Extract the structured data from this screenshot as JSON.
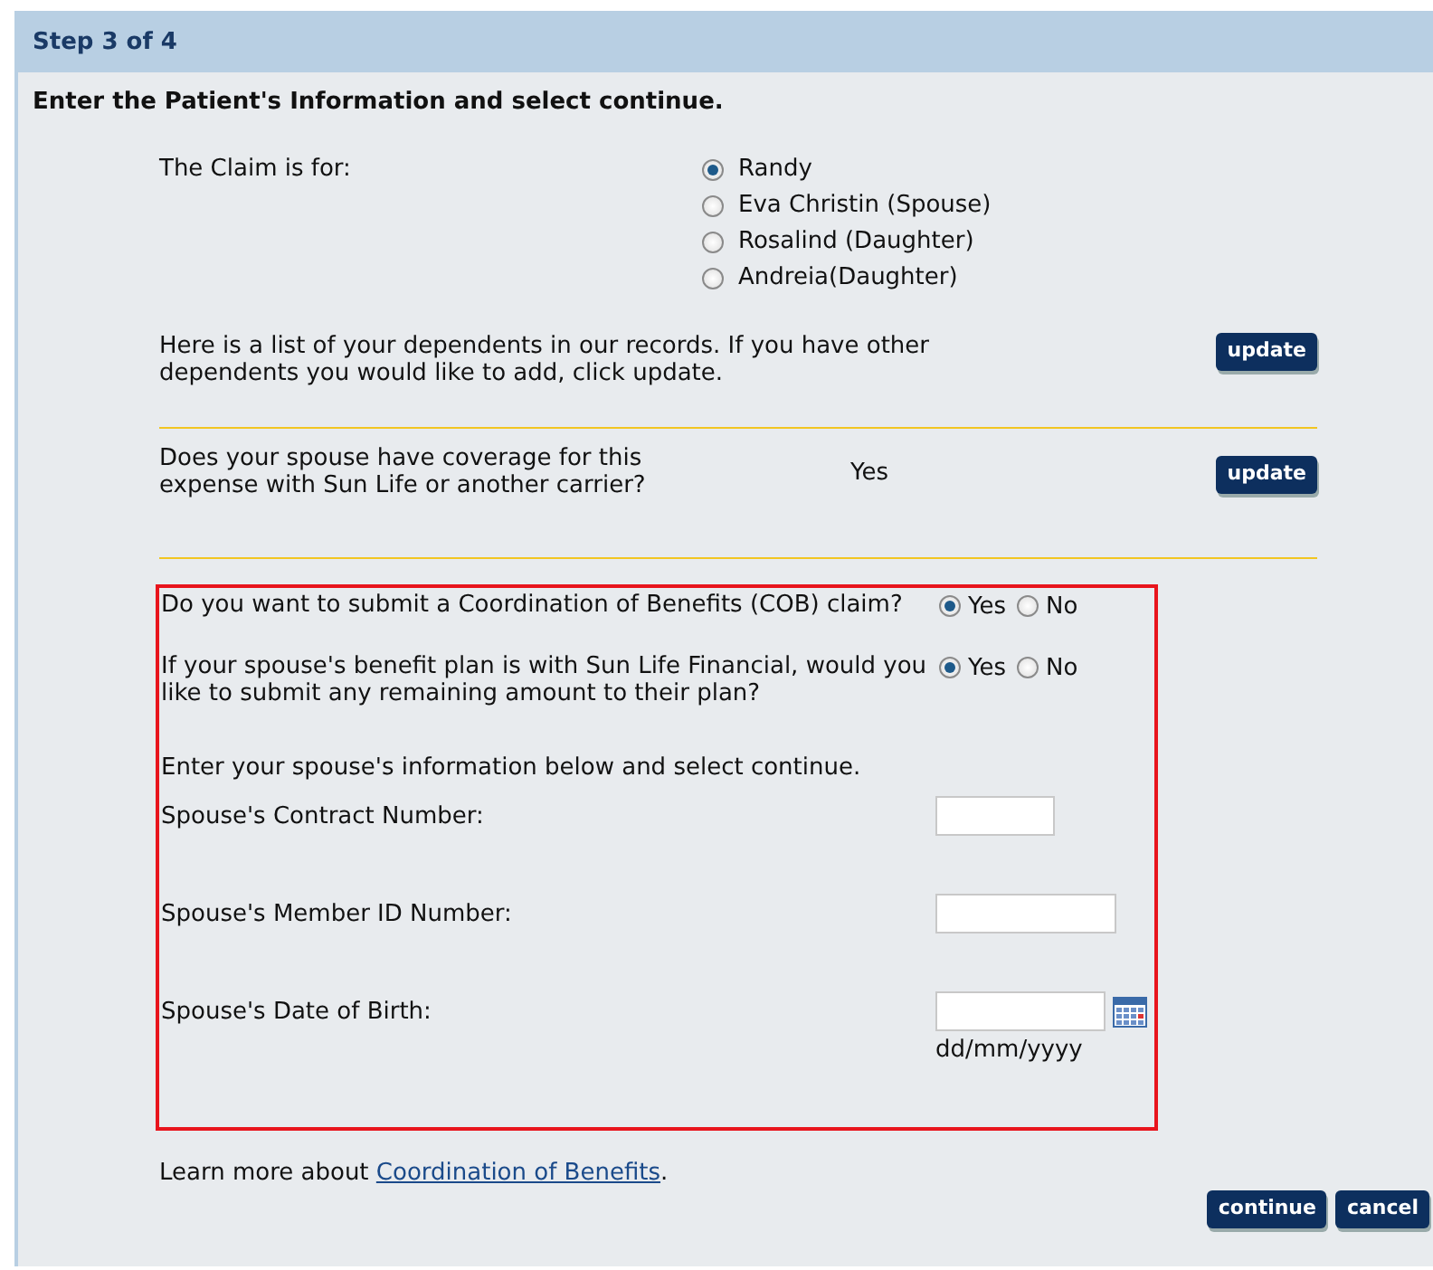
{
  "step": "Step 3 of 4",
  "instruction": "Enter the Patient's Information and select continue.",
  "claim": {
    "label": "The Claim is for:",
    "options": [
      {
        "label": "Randy",
        "selected": true
      },
      {
        "label": "Eva Christin (Spouse)",
        "selected": false
      },
      {
        "label": "Rosalind (Daughter)",
        "selected": false
      },
      {
        "label": "Andreia(Daughter)",
        "selected": false
      }
    ]
  },
  "dependents": {
    "text": "Here is a list of your dependents in our records. If you have other dependents you would like to add, click update.",
    "button": "update"
  },
  "coverage": {
    "question": "Does your spouse have coverage for this expense with Sun Life or another carrier?",
    "answer": "Yes",
    "button": "update"
  },
  "cob": {
    "questions": [
      {
        "text": "Do you want to submit a Coordination of Benefits (COB) claim?",
        "options": [
          {
            "label": "Yes",
            "selected": true
          },
          {
            "label": "No",
            "selected": false
          }
        ]
      },
      {
        "text": "If your spouse's benefit plan is with Sun Life Financial, would you like to submit any remaining amount to their plan?",
        "options": [
          {
            "label": "Yes",
            "selected": true
          },
          {
            "label": "No",
            "selected": false
          }
        ]
      }
    ],
    "intro": "Enter your spouse's information below and select continue.",
    "fields": [
      {
        "label": "Spouse's Contract Number:",
        "kind": "short"
      },
      {
        "label": "Spouse's Member ID Number:",
        "kind": "medium"
      },
      {
        "label": "Spouse's Date of Birth:",
        "kind": "date",
        "hint": "dd/mm/yyyy"
      }
    ]
  },
  "learn_more": {
    "text": "Learn more about ",
    "link": "Coordination of Benefits",
    "end": "."
  },
  "buttons": [
    "continue",
    "cancel"
  ]
}
